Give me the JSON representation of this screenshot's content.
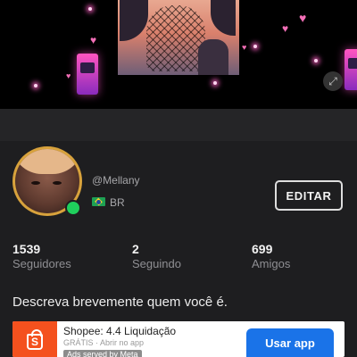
{
  "banner": {
    "expand_icon": "expand-icon",
    "accent_color": "#f36fb7"
  },
  "profile": {
    "username": "@Mellany",
    "country_flag": "brazil-flag-icon",
    "country": "BR",
    "online_status_color": "#1fcf5c",
    "edit_label": "EDITAR"
  },
  "stats": [
    {
      "value": "1539",
      "label": "Seguidores"
    },
    {
      "value": "2",
      "label": "Seguindo"
    },
    {
      "value": "699",
      "label": "Amigos"
    }
  ],
  "bio_placeholder": "Descreva brevemente quem você é.",
  "ad": {
    "title": "Shopee: 4.4 Liquidação",
    "subtitle": "GRÁTIS · Abrir no app",
    "attribution": "Ads served by Meta",
    "cta_label": "Usar app",
    "logo_letter": "S",
    "brand_color": "#f4511e",
    "cta_color": "#1a73e8"
  }
}
